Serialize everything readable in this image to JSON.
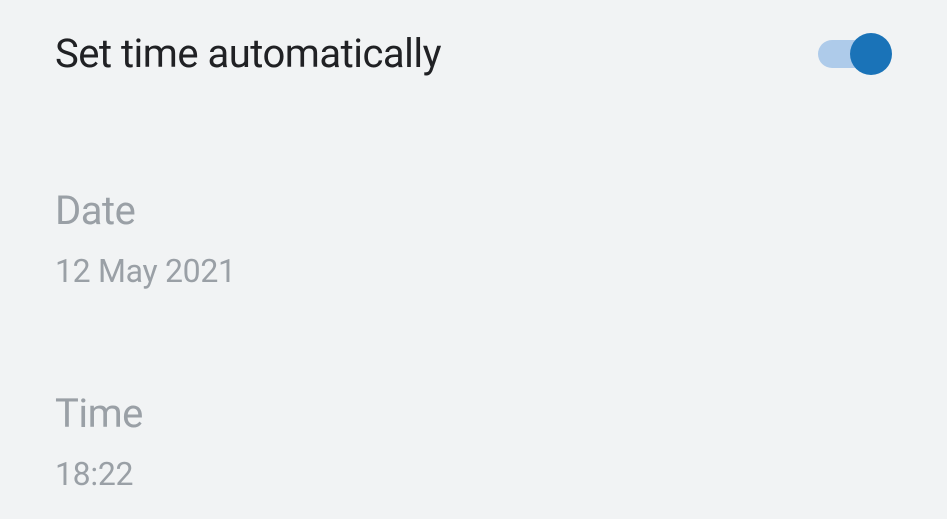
{
  "auto_time": {
    "label": "Set time automatically",
    "enabled": true
  },
  "date": {
    "label": "Date",
    "value": "12 May 2021"
  },
  "time": {
    "label": "Time",
    "value": "18:22"
  }
}
